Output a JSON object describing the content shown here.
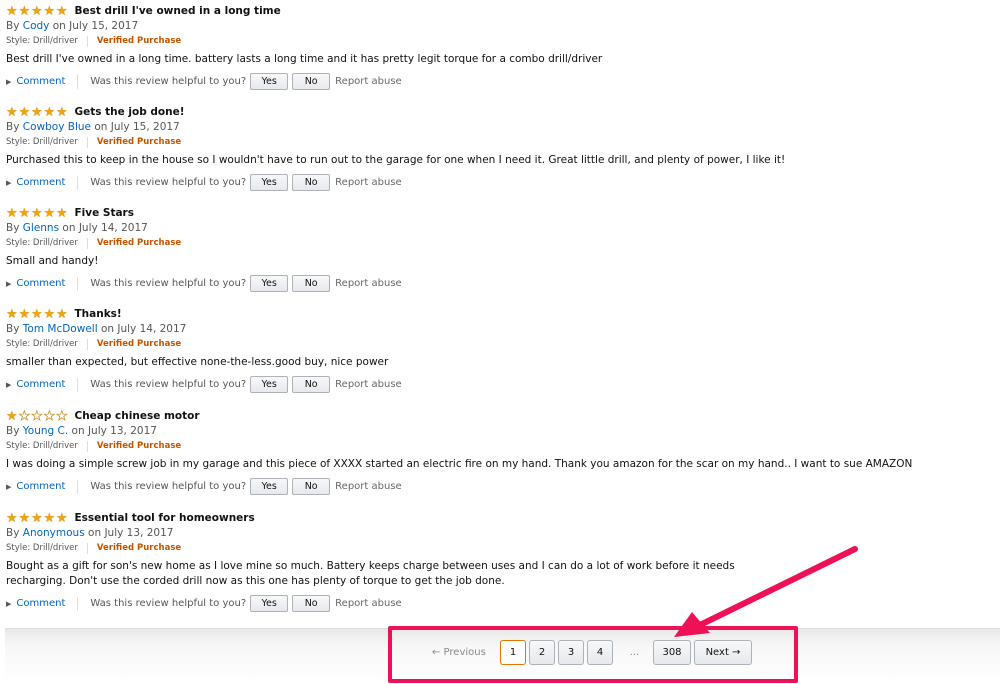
{
  "reviews": [
    {
      "stars": 5,
      "title": "Best drill I've owned in a long time",
      "by": "By",
      "author": "Cody",
      "date": "on July 15, 2017",
      "style": "Style: Drill/driver",
      "verified": "Verified Purchase",
      "body": "Best drill I've owned in a long time. battery lasts a long time and it has pretty legit torque for a combo drill/driver"
    },
    {
      "stars": 5,
      "title": "Gets the job done!",
      "by": "By",
      "author": "Cowboy Blue",
      "date": "on July 15, 2017",
      "style": "Style: Drill/driver",
      "verified": "Verified Purchase",
      "body": "Purchased this to keep in the house so I wouldn't have to run out to the garage for one when I need it. Great little drill, and plenty of power, I like it!"
    },
    {
      "stars": 5,
      "title": "Five Stars",
      "by": "By",
      "author": "Glenns",
      "date": "on July 14, 2017",
      "style": "Style: Drill/driver",
      "verified": "Verified Purchase",
      "body": "Small and handy!"
    },
    {
      "stars": 5,
      "title": "Thanks!",
      "by": "By",
      "author": "Tom McDowell",
      "date": "on July 14, 2017",
      "style": "Style: Drill/driver",
      "verified": "Verified Purchase",
      "body": "smaller than expected, but effective none-the-less.good buy, nice power"
    },
    {
      "stars": 1,
      "title": "Cheap chinese motor",
      "by": "By",
      "author": "Young C.",
      "date": "on July 13, 2017",
      "style": "Style: Drill/driver",
      "verified": "Verified Purchase",
      "body": "I was doing a simple screw job in my garage and this piece of XXXX started an electric fire on my hand. Thank you amazon for the scar on my hand.. I want to sue AMAZON"
    },
    {
      "stars": 5,
      "title": "Essential tool for homeowners",
      "by": "By",
      "author": "Anonymous",
      "date": "on July 13, 2017",
      "style": "Style: Drill/driver",
      "verified": "Verified Purchase",
      "body": "Bought as a gift for son's new home as I love mine so much. Battery keeps charge between uses and I can do a lot of work before it needs recharging. Don't use the corded drill now as this one has plenty of torque to get the job done."
    }
  ],
  "actions": {
    "comment": "Comment",
    "helpful": "Was this review helpful to you?",
    "yes": "Yes",
    "no": "No",
    "report": "Report abuse"
  },
  "pagination": {
    "previous": "← Previous",
    "pages": [
      "1",
      "2",
      "3",
      "4"
    ],
    "ellipsis": "...",
    "last": "308",
    "next": "Next →",
    "current": "1"
  },
  "colors": {
    "highlight": "#ee1155",
    "star": "#f0a30a",
    "link": "#0066c0",
    "verified": "#c45500"
  }
}
